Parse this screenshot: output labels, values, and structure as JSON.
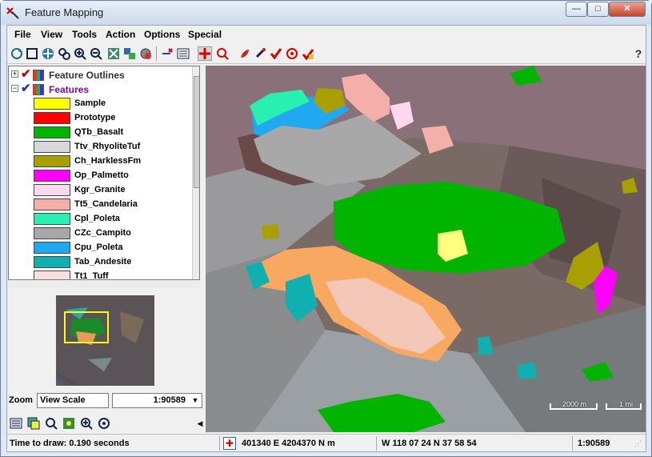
{
  "window": {
    "title": "Feature Mapping"
  },
  "menu": [
    "File",
    "View",
    "Tools",
    "Action",
    "Options",
    "Special"
  ],
  "toolbar": {
    "icons": [
      "redraw-icon",
      "full-view-icon",
      "pan-icon",
      "zoom-box-icon",
      "zoom-in-icon",
      "zoom-out-icon",
      "zoom-active-icon",
      "zoom-previous-icon",
      "globe-icon",
      "add-layer-icon",
      "layer-list-icon",
      "move-icon",
      "zoom-circle-icon",
      "paint-brush-icon",
      "dropper-icon",
      "check-icon",
      "target-check-icon",
      "multi-check-icon",
      "help-icon"
    ]
  },
  "layers": {
    "outlines": {
      "name": "Feature Outlines"
    },
    "features": {
      "name": "Features",
      "legend": [
        {
          "label": "Sample",
          "color": "#ffff00"
        },
        {
          "label": "Prototype",
          "color": "#ff0000"
        },
        {
          "label": "QTb_Basalt",
          "color": "#00b400"
        },
        {
          "label": "Ttv_RhyoliteTuf",
          "color": "#d8d8d8"
        },
        {
          "label": "Ch_HarklessFm",
          "color": "#a8a000"
        },
        {
          "label": "Op_Palmetto",
          "color": "#ff00ff"
        },
        {
          "label": "Kgr_Granite",
          "color": "#ffd8f0"
        },
        {
          "label": "Tt5_Candelaria",
          "color": "#f4b0a8"
        },
        {
          "label": "Cpl_Poleta",
          "color": "#28f0b0"
        },
        {
          "label": "CZc_Campito",
          "color": "#a8a8a8"
        },
        {
          "label": "Cpu_Poleta",
          "color": "#20a8f0"
        },
        {
          "label": "Tab_Andesite",
          "color": "#10b0b0"
        },
        {
          "label": "Tt1_Tuff",
          "color": "#f8e0e0"
        }
      ]
    }
  },
  "zoom": {
    "label": "Zoom",
    "mode": "View Scale",
    "scale": "1:90589"
  },
  "map": {
    "scalebar_km": "2000 m",
    "scalebar_mi": "1 mi"
  },
  "status": {
    "draw_time": "Time to draw: 0.190 seconds",
    "coords_utm": "401340 E  4204370 N m",
    "coords_geo": "W 118 07 24  N 37 58 54",
    "scale": "1:90589"
  }
}
